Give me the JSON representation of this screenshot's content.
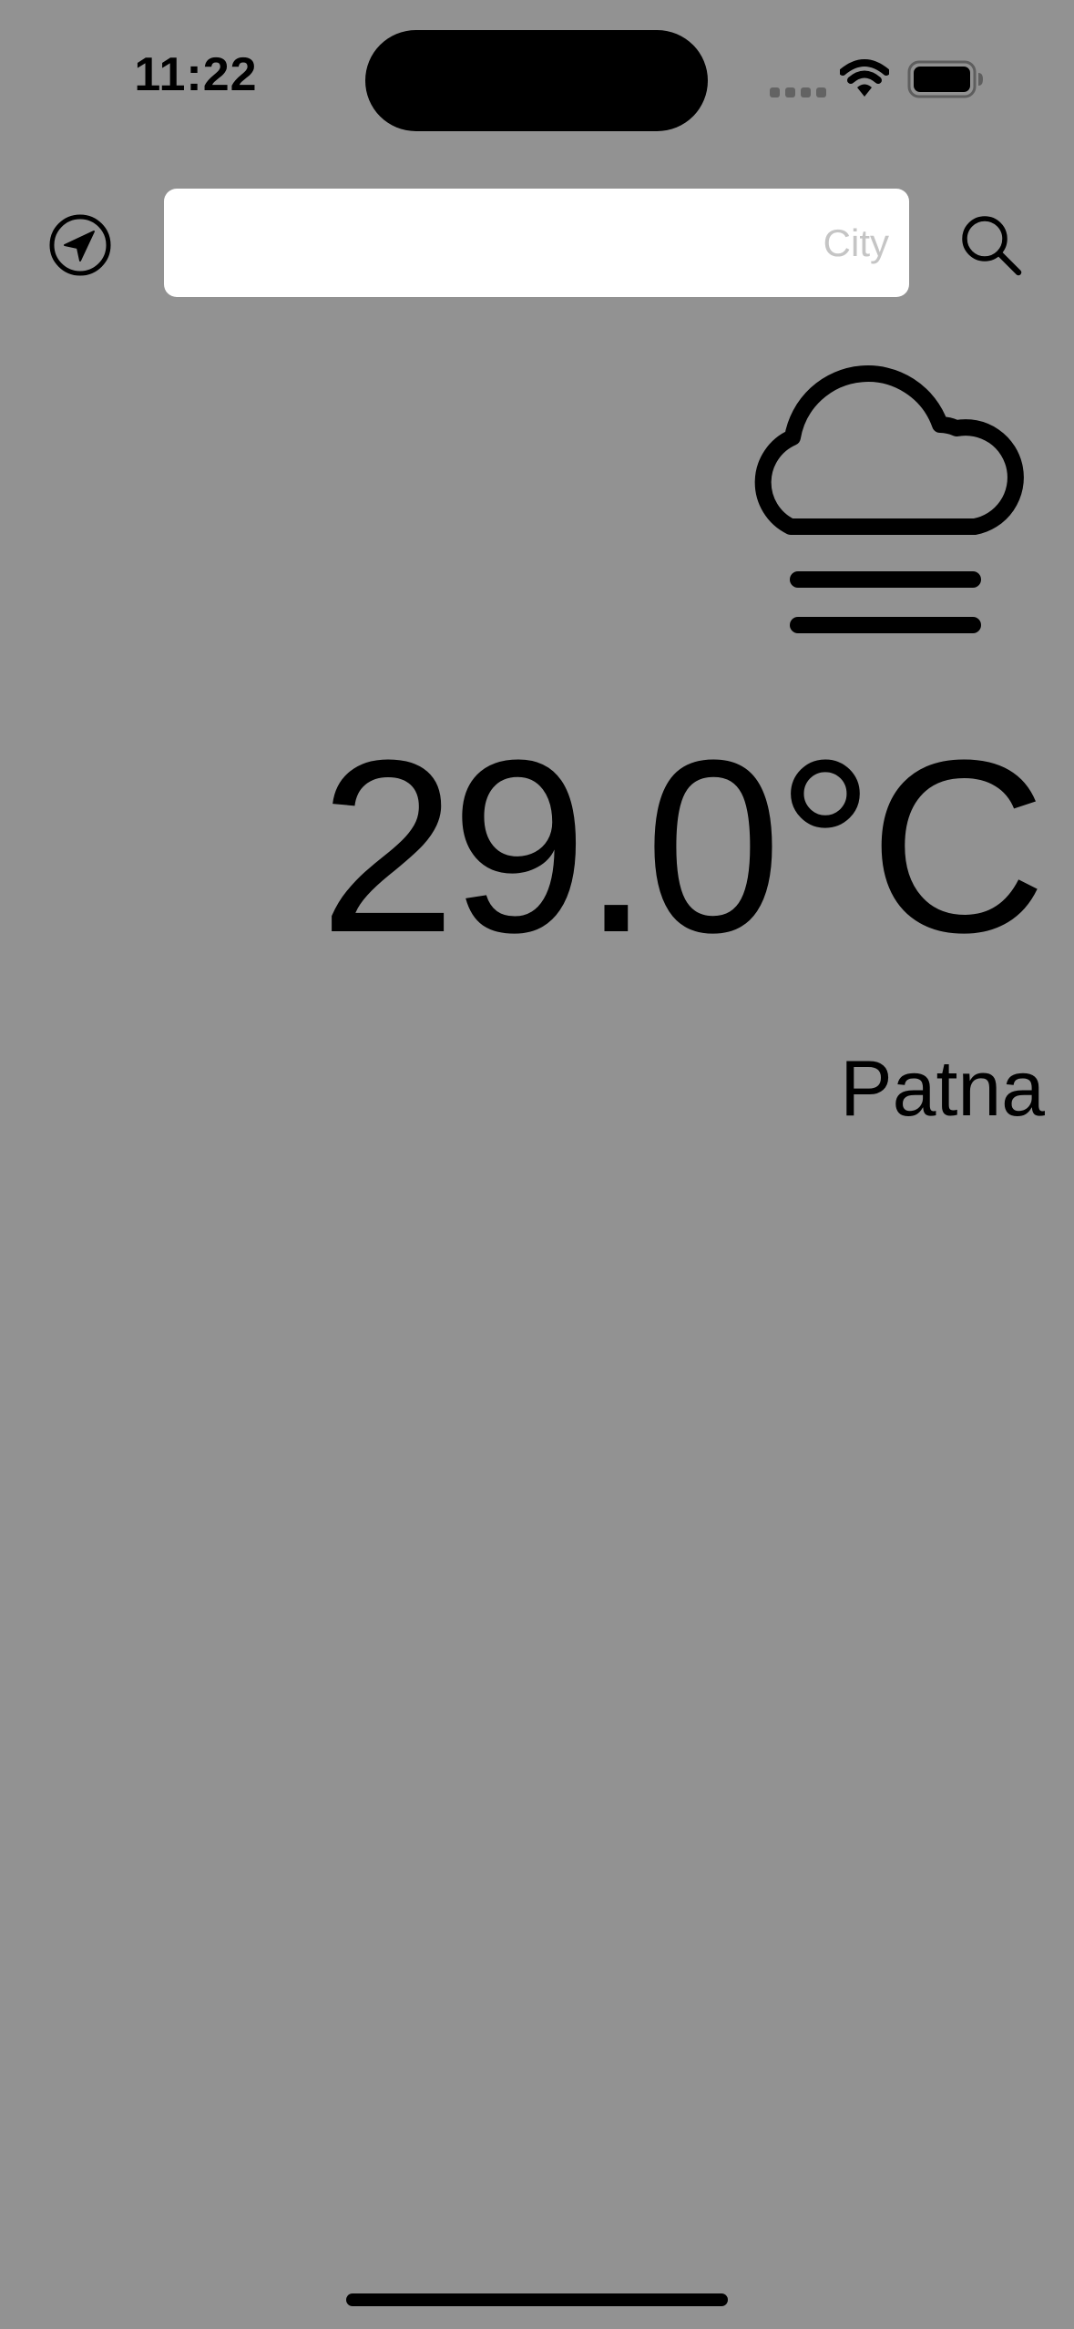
{
  "status_bar": {
    "time": "11:22",
    "icons": [
      "signal-icon",
      "wifi-icon",
      "battery-icon"
    ]
  },
  "header": {
    "location_icon": "location-arrow-icon",
    "search": {
      "placeholder": "City",
      "value": ""
    },
    "search_icon": "magnifying-glass-icon"
  },
  "weather": {
    "condition_icon": "cloud-fog-icon",
    "temperature": "29.0°C",
    "city": "Patna"
  },
  "colors": {
    "background": "#929292",
    "input_background": "#ffffff",
    "placeholder": "#c5c5c5",
    "foreground": "#000000"
  }
}
